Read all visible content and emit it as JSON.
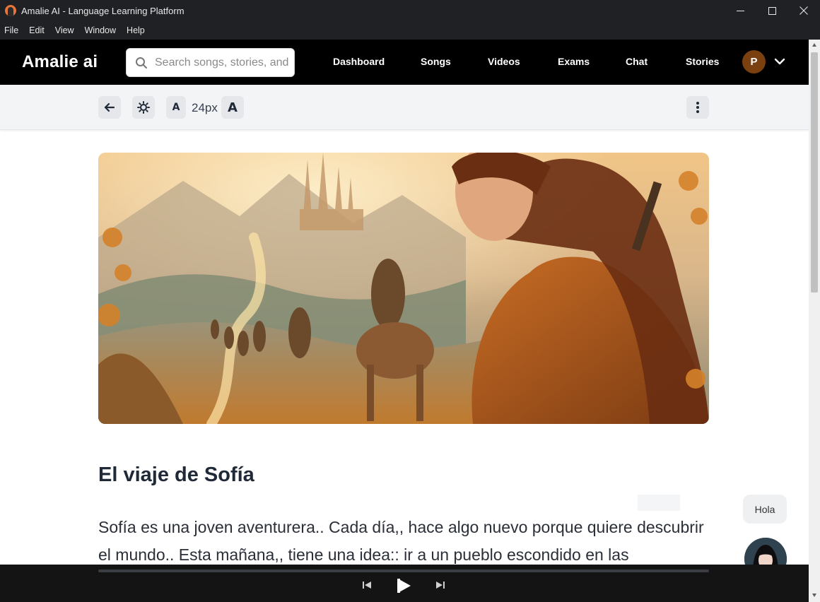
{
  "window": {
    "title": "Amalie AI - Language Learning Platform",
    "controls": [
      "minimize-icon",
      "maximize-icon",
      "close-icon"
    ]
  },
  "menubar": {
    "items": [
      "File",
      "Edit",
      "View",
      "Window",
      "Help"
    ]
  },
  "header": {
    "brand": "Amalie ai",
    "search_placeholder": "Search songs, stories, and",
    "nav": [
      "Dashboard",
      "Songs",
      "Videos",
      "Exams",
      "Chat",
      "Stories"
    ],
    "avatar_initial": "P",
    "avatar_color": "#7a4010"
  },
  "toolbar": {
    "back_icon": "arrow-left-icon",
    "theme_icon": "sun-icon",
    "decrease_font_label": "A",
    "font_size": "24px",
    "increase_font_label": "A",
    "more_icon": "more-vertical-icon"
  },
  "story": {
    "title": "El viaje de Sofía",
    "text": "Sofía es una joven aventurera.. Cada día,, hace algo nuevo porque quiere descubrir el mundo.. Esta mañana,, tiene una idea:: ir a un pueblo escondido en las montañas.."
  },
  "chat_widget": {
    "greeting": "Hola"
  },
  "player": {
    "progress": 0.0,
    "controls": [
      "skip-back-icon",
      "play-icon",
      "skip-forward-icon"
    ]
  },
  "colors": {
    "header_bg": "#000000",
    "titlebar_bg": "#1f2124",
    "toolbar_bg": "#f3f4f6",
    "player_bg": "#141414"
  }
}
